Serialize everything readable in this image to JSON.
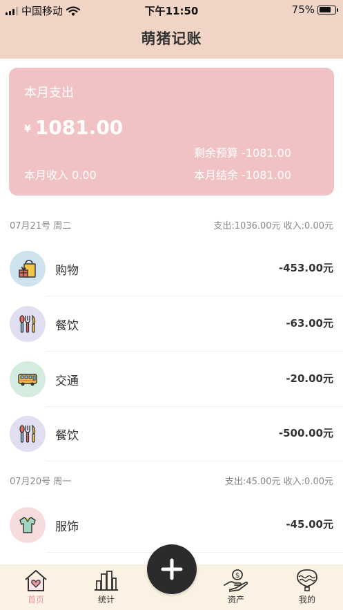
{
  "status_bar": {
    "carrier": "中国移动",
    "time": "下午11:50",
    "battery": "75%",
    "battery_level": 0.75
  },
  "header": {
    "title": "萌猪记账"
  },
  "summary": {
    "label": "本月支出",
    "currency": "¥",
    "amount": "1081.00",
    "budget": "剩余预算 -1081.00",
    "income": "本月收入 0.00",
    "balance": "本月结余 -1081.00"
  },
  "days": [
    {
      "date": "07月21号  周二",
      "totals": "支出:1036.00元  收入:0.00元",
      "items": [
        {
          "category": "购物",
          "amount": "-453.00元",
          "icon": "shopping-bag-icon",
          "bg": "#cfe3ef"
        },
        {
          "category": "餐饮",
          "amount": "-63.00元",
          "icon": "utensils-icon",
          "bg": "#e0def0"
        },
        {
          "category": "交通",
          "amount": "-20.00元",
          "icon": "bus-icon",
          "bg": "#d4ebdf"
        },
        {
          "category": "餐饮",
          "amount": "-500.00元",
          "icon": "utensils-icon",
          "bg": "#e0def0"
        }
      ]
    },
    {
      "date": "07月20号  周一",
      "totals": "支出:45.00元  收入:0.00元",
      "items": [
        {
          "category": "服饰",
          "amount": "-45.00元",
          "icon": "shirt-icon",
          "bg": "#f6dcdc"
        }
      ]
    }
  ],
  "tabbar": {
    "home": "首页",
    "stats": "统计",
    "assets": "资产",
    "mine": "我的"
  },
  "colors": {
    "header_bg": "#f0d5c6",
    "card_bg": "#f1c2c4",
    "tabbar_bg": "#fbf2e3",
    "active_tab": "#e89aa0",
    "fab": "#2b2b2b"
  }
}
